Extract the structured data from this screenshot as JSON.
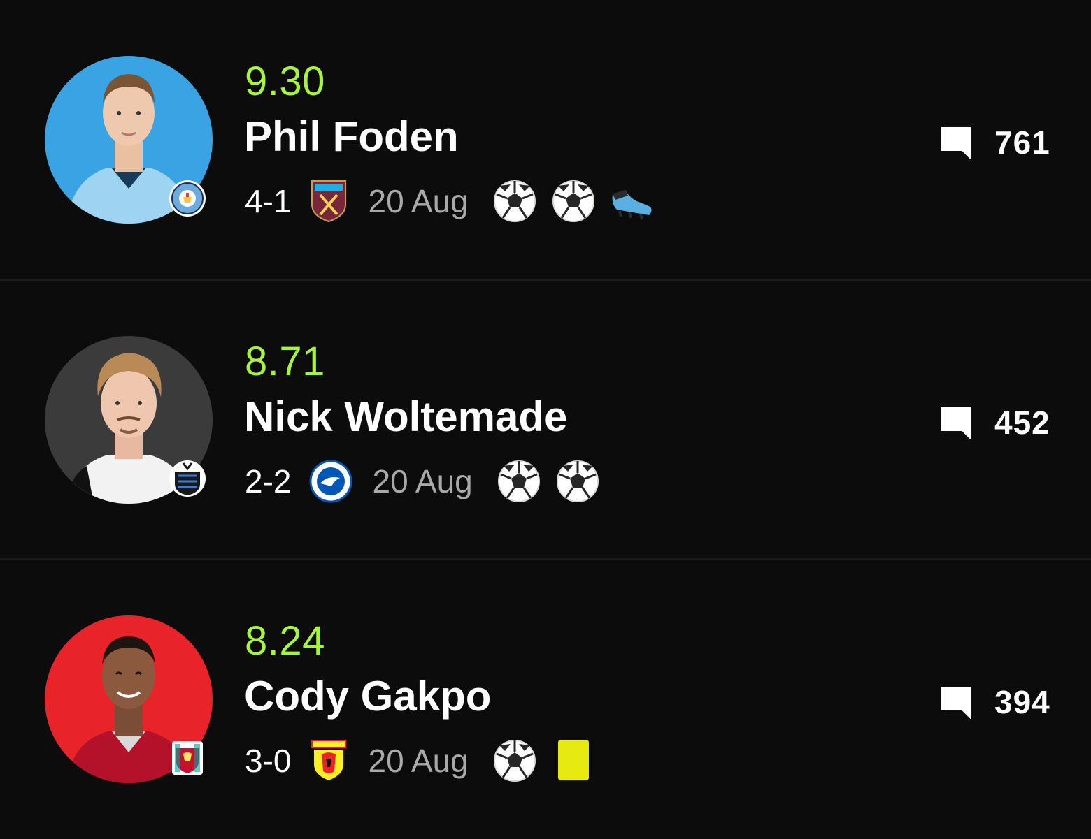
{
  "colors": {
    "background": "#0c0c0c",
    "rating": "#a6f53c",
    "date": "#a9a9a9",
    "divider": "#1c1c1c"
  },
  "players": [
    {
      "rating": "9.30",
      "name": "Phil Foden",
      "score": "4-1",
      "opponent_icon": "west-ham-crest-icon",
      "club_icon": "manchester-city-crest-icon",
      "date": "20 Aug",
      "events": [
        "goal",
        "goal",
        "assist"
      ],
      "comments": "761",
      "avatar_bg": "#3aa3e3"
    },
    {
      "rating": "8.71",
      "name": "Nick Woltemade",
      "score": "2-2",
      "opponent_icon": "brighton-crest-icon",
      "club_icon": "newcastle-crest-icon",
      "date": "20 Aug",
      "events": [
        "goal",
        "goal"
      ],
      "comments": "452",
      "avatar_bg": "#3b3b3b"
    },
    {
      "rating": "8.24",
      "name": "Cody Gakpo",
      "score": "3-0",
      "opponent_icon": "watford-crest-icon",
      "club_icon": "liverpool-crest-icon",
      "date": "20 Aug",
      "events": [
        "goal",
        "yellow-card"
      ],
      "comments": "394",
      "avatar_bg": "#e8232a"
    }
  ]
}
